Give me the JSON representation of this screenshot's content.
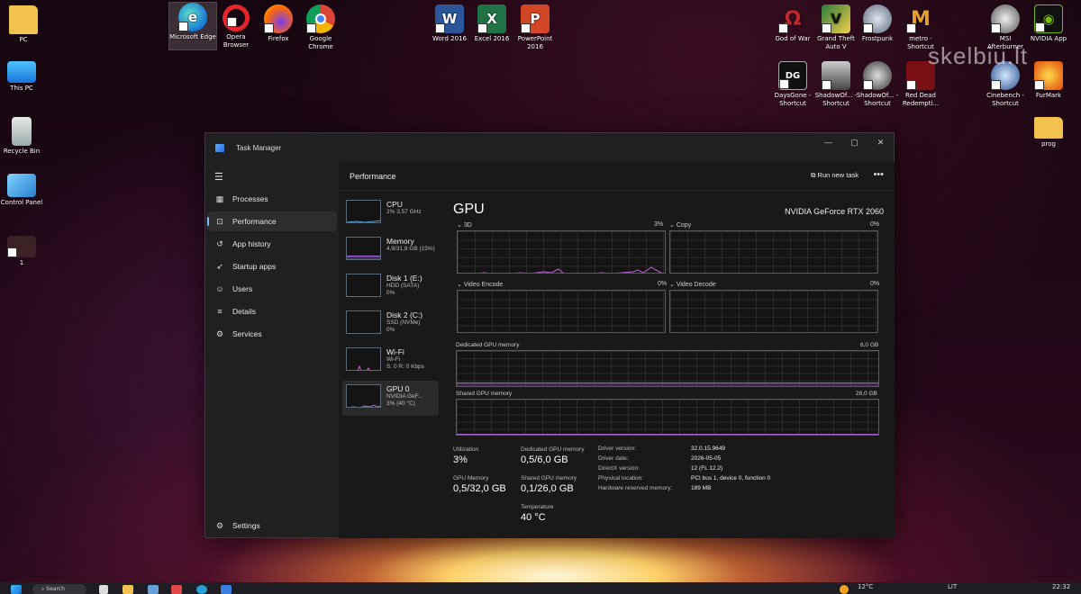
{
  "desktop": {
    "icons": [
      {
        "label": "PC"
      },
      {
        "label": "This PC"
      },
      {
        "label": "Recycle Bin"
      },
      {
        "label": "Control Panel"
      },
      {
        "label": "1"
      },
      {
        "label": "Microsoft Edge"
      },
      {
        "label": "Opera Browser"
      },
      {
        "label": "Firefox"
      },
      {
        "label": "Google Chrome"
      },
      {
        "label": "Word 2016"
      },
      {
        "label": "Excel 2016"
      },
      {
        "label": "PowerPoint 2016"
      },
      {
        "label": "God of War"
      },
      {
        "label": "Grand Theft Auto V"
      },
      {
        "label": "Frostpunk"
      },
      {
        "label": "metro - Shortcut"
      },
      {
        "label": "MSI Afterburner"
      },
      {
        "label": "NVIDIA App"
      },
      {
        "label": "DaysGone - Shortcut"
      },
      {
        "label": "ShadowOf... - Shortcut"
      },
      {
        "label": "ShadowOf... - Shortcut"
      },
      {
        "label": "Red Dead Redempti..."
      },
      {
        "label": "Cinebench - Shortcut"
      },
      {
        "label": "FurMark"
      },
      {
        "label": "prog"
      }
    ],
    "watermark": "skelbiu.lt"
  },
  "window": {
    "title": "Task Manager",
    "controls": {
      "minimize": "—",
      "maximize": "▢",
      "close": "✕"
    }
  },
  "nav": {
    "items": [
      {
        "label": "Processes",
        "icon": "processes-icon"
      },
      {
        "label": "Performance",
        "icon": "performance-icon"
      },
      {
        "label": "App history",
        "icon": "history-icon"
      },
      {
        "label": "Startup apps",
        "icon": "startup-icon"
      },
      {
        "label": "Users",
        "icon": "users-icon"
      },
      {
        "label": "Details",
        "icon": "details-icon"
      },
      {
        "label": "Services",
        "icon": "services-icon"
      }
    ],
    "settings": "Settings"
  },
  "header": {
    "title": "Performance",
    "run_task": "Run new task",
    "more": "•••"
  },
  "resources": [
    {
      "name": "CPU",
      "l2": "2% 3,57 GHz",
      "l3": ""
    },
    {
      "name": "Memory",
      "l2": "4,9/31,9 GB (15%)",
      "l3": ""
    },
    {
      "name": "Disk 1 (E:)",
      "l2": "HDD (SATA)",
      "l3": "0%"
    },
    {
      "name": "Disk 2 (C:)",
      "l2": "SSD (NVMe)",
      "l3": "0%"
    },
    {
      "name": "Wi-Fi",
      "l2": "Wi-Fi",
      "l3": "S: 0 R: 0 Kbps"
    },
    {
      "name": "GPU 0",
      "l2": "NVIDIA GeF...",
      "l3": "3% (40 °C)"
    }
  ],
  "gpu": {
    "title": "GPU",
    "model": "NVIDIA GeForce RTX 2060",
    "graphs": {
      "g3d": {
        "label": "3D",
        "value": "3%"
      },
      "copy": {
        "label": "Copy",
        "value": "0%"
      },
      "encode": {
        "label": "Video Encode",
        "value": "0%"
      },
      "decode": {
        "label": "Video Decode",
        "value": "0%"
      },
      "dedicated": {
        "label": "Dedicated GPU memory",
        "value": "6,0 GB"
      },
      "shared": {
        "label": "Shared GPU memory",
        "value": "26,0 GB"
      }
    },
    "stats": {
      "utilization": {
        "k": "Utilization",
        "v": "3%"
      },
      "dedicated": {
        "k": "Dedicated GPU memory",
        "v": "0,5/6,0 GB"
      },
      "gpumem": {
        "k": "GPU Memory",
        "v": "0,5/32,0 GB"
      },
      "shared": {
        "k": "Shared GPU memory",
        "v": "0,1/26,0 GB"
      },
      "temp": {
        "k": "Temperature",
        "v": "40 °C"
      }
    },
    "details": [
      {
        "k": "Driver version:",
        "v": "32.0.15.9649"
      },
      {
        "k": "Driver date:",
        "v": "2026-05-05"
      },
      {
        "k": "DirectX version:",
        "v": "12 (FL 12.2)"
      },
      {
        "k": "Physical location:",
        "v": "PCI bus 1, device 0, function 0"
      },
      {
        "k": "Hardware reserved memory:",
        "v": "189 MB"
      }
    ]
  },
  "taskbar": {
    "search": "Search",
    "weather": "12°C",
    "lang": "LIT",
    "time": "22:32"
  }
}
